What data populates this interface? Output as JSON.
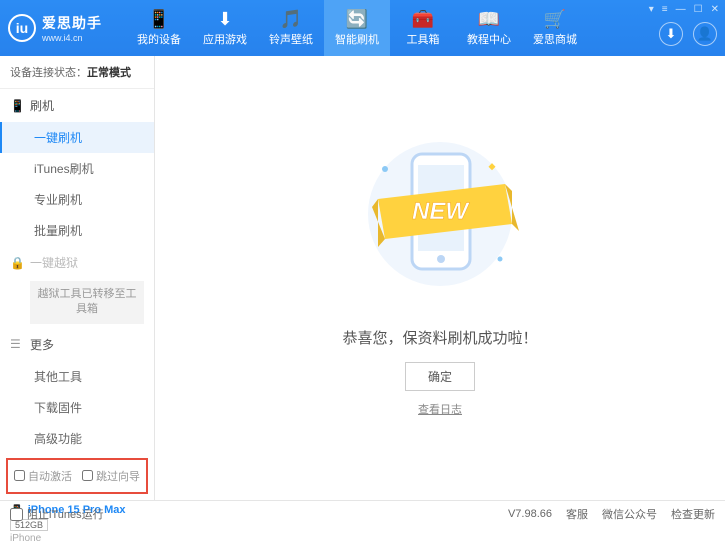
{
  "logo": {
    "title": "爱思助手",
    "sub": "www.i4.cn",
    "glyph": "iu"
  },
  "nav": [
    {
      "icon": "📱",
      "label": "我的设备"
    },
    {
      "icon": "⬇",
      "label": "应用游戏"
    },
    {
      "icon": "🎵",
      "label": "铃声壁纸"
    },
    {
      "icon": "🔄",
      "label": "智能刷机",
      "active": true
    },
    {
      "icon": "🧰",
      "label": "工具箱"
    },
    {
      "icon": "📖",
      "label": "教程中心"
    },
    {
      "icon": "🛒",
      "label": "爱思商城"
    }
  ],
  "status": {
    "prefix": "设备连接状态：",
    "value": "正常模式"
  },
  "sections": {
    "flash": {
      "icon": "📱",
      "title": "刷机",
      "items": [
        "一键刷机",
        "iTunes刷机",
        "专业刷机",
        "批量刷机"
      ]
    },
    "jailbreak": {
      "icon": "🔒",
      "title": "一键越狱",
      "note": "越狱工具已转移至工具箱"
    },
    "more": {
      "icon": "☰",
      "title": "更多",
      "items": [
        "其他工具",
        "下载固件",
        "高级功能"
      ]
    }
  },
  "checks": {
    "auto": "自动激活",
    "skip": "跳过向导"
  },
  "device": {
    "name": "iPhone 15 Pro Max",
    "storage": "512GB",
    "type": "iPhone"
  },
  "content": {
    "msg": "恭喜您，保资料刷机成功啦！",
    "ok": "确定",
    "log": "查看日志"
  },
  "footer": {
    "block": "阻止iTunes运行",
    "version": "V7.98.66",
    "items": [
      "客服",
      "微信公众号",
      "检查更新"
    ]
  }
}
